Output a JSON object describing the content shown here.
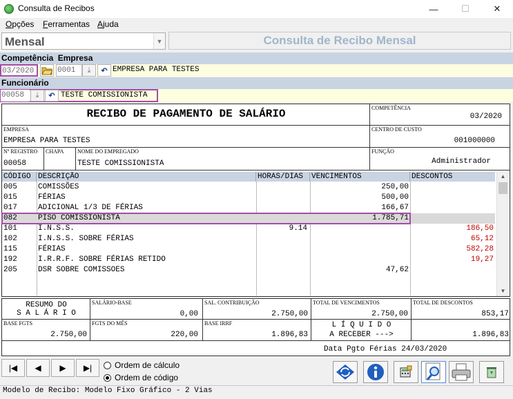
{
  "window": {
    "title": "Consulta de Recibos",
    "minimize": "—",
    "maximize": "☐",
    "close": "✕"
  },
  "menu": [
    "Opções",
    "Ferramentas",
    "Ajuda"
  ],
  "mode": {
    "value": "Mensal",
    "header_title": "Consulta de Recibo Mensal"
  },
  "labels": {
    "competencia": "Competência",
    "empresa": "Empresa",
    "funcionario": "Funcionário"
  },
  "fields": {
    "competencia": "03/2020",
    "empresa_code": "0001",
    "empresa_name": "EMPRESA PARA TESTES",
    "funcionario_code": "00058",
    "funcionario_name": "TESTE COMISSIONISTA"
  },
  "receipt": {
    "title": "RECIBO DE PAGAMENTO DE SALÁRIO",
    "competencia_label": "COMPETÊNCIA",
    "competencia": "03/2020",
    "empresa_label": "EMPRESA",
    "empresa": "EMPRESA PARA TESTES",
    "centro_label": "CENTRO DE CUSTO",
    "centro": "001000000",
    "registro_label": "Nº REGISTRO",
    "registro": "00058",
    "chapa_label": "CHAPA",
    "nome_label": "NOME DO EMPREGADO",
    "nome": "TESTE COMISSIONISTA",
    "funcao_label": "FUNÇÃO",
    "funcao": "Administrador",
    "columns": [
      "CÓDIGO",
      "DESCRIÇÃO",
      "HORAS/DIAS",
      "VENCIMENTOS",
      "DESCONTOS"
    ],
    "rows": [
      {
        "code": "005",
        "desc": "COMISSÕES",
        "horas": "",
        "venc": "250,00",
        "desc_val": ""
      },
      {
        "code": "015",
        "desc": "FÉRIAS",
        "horas": "",
        "venc": "500,00",
        "desc_val": ""
      },
      {
        "code": "017",
        "desc": "ADICIONAL 1/3 DE FÉRIAS",
        "horas": "",
        "venc": "166,67",
        "desc_val": ""
      },
      {
        "code": "082",
        "desc": "PISO COMISSIONISTA",
        "horas": "",
        "venc": "1.785,71",
        "desc_val": ""
      },
      {
        "code": "101",
        "desc": "I.N.S.S.",
        "horas": "9.14",
        "venc": "",
        "desc_val": "186,50"
      },
      {
        "code": "102",
        "desc": "I.N.S.S. SOBRE FÉRIAS",
        "horas": "",
        "venc": "",
        "desc_val": "65,12"
      },
      {
        "code": "115",
        "desc": "FÉRIAS",
        "horas": "",
        "venc": "",
        "desc_val": "582,28"
      },
      {
        "code": "192",
        "desc": "I.R.R.F. SOBRE FÉRIAS RETIDO",
        "horas": "",
        "venc": "",
        "desc_val": "19,27"
      },
      {
        "code": "205",
        "desc": "DSR SOBRE COMISSOES",
        "horas": "",
        "venc": "47,62",
        "desc_val": ""
      }
    ],
    "resumo_line1": "RESUMO DO",
    "resumo_line2": "S A L Á R I O",
    "salario_base_label": "SALÁRIO-BASE",
    "salario_base": "0,00",
    "sal_contrib_label": "SAL. CONTRIBUIÇÃO",
    "sal_contrib": "2.750,00",
    "total_venc_label": "TOTAL DE VENCIMENTOS",
    "total_venc": "2.750,00",
    "total_desc_label": "TOTAL DE DESCONTOS",
    "total_desc": "853,17",
    "base_fgts_label": "BASE FGTS",
    "base_fgts": "2.750,00",
    "fgts_mes_label": "FGTS DO MÊS",
    "fgts_mes": "220,00",
    "base_irrf_label": "BASE IRRF",
    "base_irrf": "1.896,83",
    "liquido_line1": "L Í Q U I D O",
    "liquido_line2": "A RECEBER --->",
    "liquido": "1.896,83",
    "data_pgto": "Data Pgto Férias 24/03/2020"
  },
  "order": {
    "calc": "Ordem de cálculo",
    "code": "Ordem de código",
    "selected": "code"
  },
  "status": "Modelo de Recibo: Modelo Fixo Gráfico - 2 Vias"
}
